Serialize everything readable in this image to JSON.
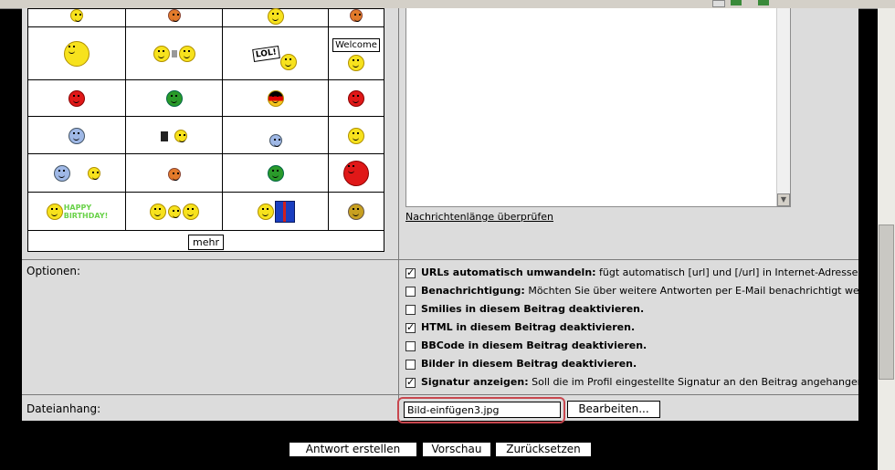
{
  "smilies": {
    "more_label": "mehr",
    "welcome_sign": "Welcome",
    "lol_sign": "LOL!",
    "happy_birthday_line1": "HAPPY",
    "happy_birthday_line2": "BIRTHDAY!"
  },
  "editor": {
    "check_length_link": "Nachrichtenlänge überprüfen"
  },
  "options": {
    "label": "Optionen:",
    "items": [
      {
        "bold": "URLs automatisch umwandeln:",
        "text": " fügt automatisch [url] und [/url] in Internet-Adressen ein.",
        "checked": true
      },
      {
        "bold": "Benachrichtigung:",
        "text": " Möchten Sie über weitere Antworten per E-Mail benachrichtigt werden?",
        "checked": false
      },
      {
        "bold": "Smilies in diesem Beitrag deaktivieren.",
        "text": "",
        "checked": false
      },
      {
        "bold": "HTML in diesem Beitrag deaktivieren.",
        "text": "",
        "checked": true
      },
      {
        "bold": "BBCode in diesem Beitrag deaktivieren.",
        "text": "",
        "checked": false
      },
      {
        "bold": "Bilder in diesem Beitrag deaktivieren.",
        "text": "",
        "checked": false
      },
      {
        "bold": "Signatur anzeigen:",
        "text": " Soll die im Profil eingestellte Signatur an den Beitrag angehangen werden?",
        "checked": true
      }
    ]
  },
  "attachment": {
    "label": "Dateianhang:",
    "file_value": "Bild-einfügen3.jpg",
    "browse_label": "Bearbeiten..."
  },
  "actions": {
    "submit_label": "Antwort erstellen",
    "preview_label": "Vorschau",
    "reset_label": "Zurücksetzen"
  },
  "colors": {
    "panel_bg": "#dcdcdc",
    "page_bg": "#000000",
    "highlight": "#c8474f"
  }
}
